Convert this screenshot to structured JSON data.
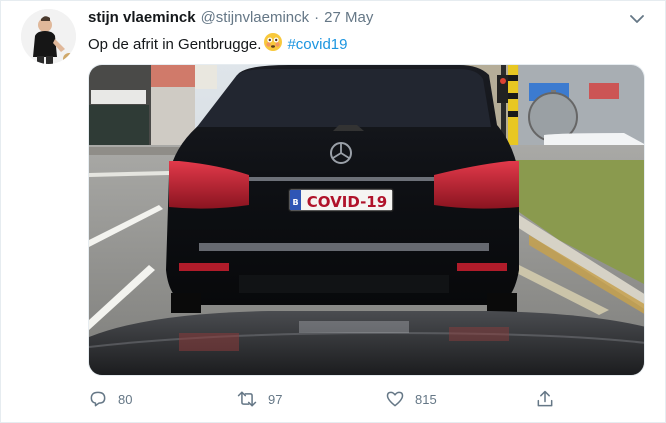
{
  "tweet": {
    "author_name": "stijn vlaeminck",
    "author_handle": "@stijnvlaeminck",
    "separator": "·",
    "date": "27 May",
    "text": "Op de afrit in Gentbrugge.",
    "emoji": "flushed-face-emoji",
    "hashtag": "#covid19",
    "image": {
      "subject": "black-car-rear-photo",
      "plate_text": "COVID-19",
      "plate_country_letter": "B"
    },
    "actions": {
      "reply_count": "80",
      "retweet_count": "97",
      "like_count": "815"
    },
    "icons": {
      "caret": "chevron-down-icon",
      "reply": "reply-icon",
      "retweet": "retweet-icon",
      "like": "heart-icon",
      "share": "share-icon"
    }
  },
  "colors": {
    "link": "#1b95e0",
    "secondary_text": "#657786",
    "primary_text": "#14171a"
  }
}
